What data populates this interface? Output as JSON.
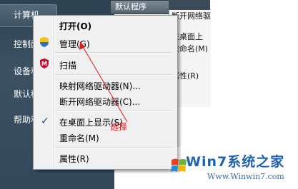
{
  "start_menu": {
    "items": [
      {
        "label": "计算机"
      },
      {
        "label": "控制面"
      },
      {
        "label": "设备和"
      },
      {
        "label": "默认程"
      },
      {
        "label": "帮助和"
      }
    ]
  },
  "explorer": {
    "default_button": "默认程序",
    "items": [
      "断开网络驱",
      "在桌面上",
      "重命名(M)",
      "属性(R)"
    ]
  },
  "context_menu": {
    "items": [
      {
        "label": "打开(O)",
        "bold": true
      },
      {
        "label": "管理(G)",
        "icon": "shield-icon"
      },
      {
        "label": "扫描",
        "icon": "antivirus-icon"
      },
      {
        "label": "映射网络驱动器(N)..."
      },
      {
        "label": "断开网络驱动器(C)..."
      },
      {
        "label": "在桌面上显示(S)",
        "checked": true
      },
      {
        "label": "重命名(M)"
      },
      {
        "label": "属性(R)"
      }
    ]
  },
  "annotation": {
    "label": "选择",
    "color": "#e0191d"
  },
  "watermark": {
    "brand": "Win7系统之家",
    "url": "Www.Winwin7.com"
  }
}
